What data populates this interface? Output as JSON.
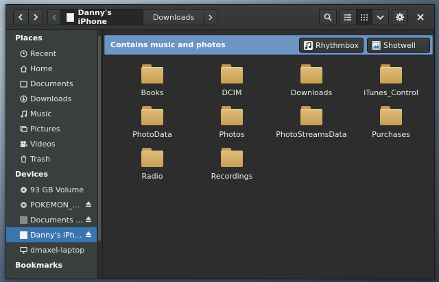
{
  "header": {
    "crumb_device": "Danny's iPhone",
    "crumb_folder": "Downloads"
  },
  "sidebar": {
    "places_title": "Places",
    "places": [
      {
        "label": "Recent",
        "icon": "clock-icon"
      },
      {
        "label": "Home",
        "icon": "home-icon"
      },
      {
        "label": "Documents",
        "icon": "folder-icon"
      },
      {
        "label": "Downloads",
        "icon": "download-icon"
      },
      {
        "label": "Music",
        "icon": "music-note-icon"
      },
      {
        "label": "Pictures",
        "icon": "picture-icon"
      },
      {
        "label": "Videos",
        "icon": "film-icon"
      },
      {
        "label": "Trash",
        "icon": "trash-icon"
      }
    ],
    "devices_title": "Devices",
    "devices": [
      {
        "label": "93 GB Volume",
        "icon": "harddisk-icon"
      },
      {
        "label": "POKEMON_...",
        "icon": "disc-icon",
        "eject": true
      },
      {
        "label": "Documents ...",
        "icon": "drive-icon",
        "eject": true
      },
      {
        "label": "Danny's iPh...",
        "icon": "phone-icon",
        "eject": true,
        "selected": true
      },
      {
        "label": "dmaxel-laptop",
        "icon": "computer-icon"
      }
    ],
    "bookmarks_title": "Bookmarks"
  },
  "infobar": {
    "message": "Contains music and photos",
    "apps": [
      "Rhythmbox",
      "Shotwell"
    ]
  },
  "files": [
    "Books",
    "DCIM",
    "Downloads",
    "iTunes_Control",
    "PhotoData",
    "Photos",
    "PhotoStreamsData",
    "Purchases",
    "Radio",
    "Recordings"
  ],
  "colors": {
    "selection": "#3b75b0",
    "infobar": "#6c95c3",
    "folder": "#d7b06a"
  }
}
